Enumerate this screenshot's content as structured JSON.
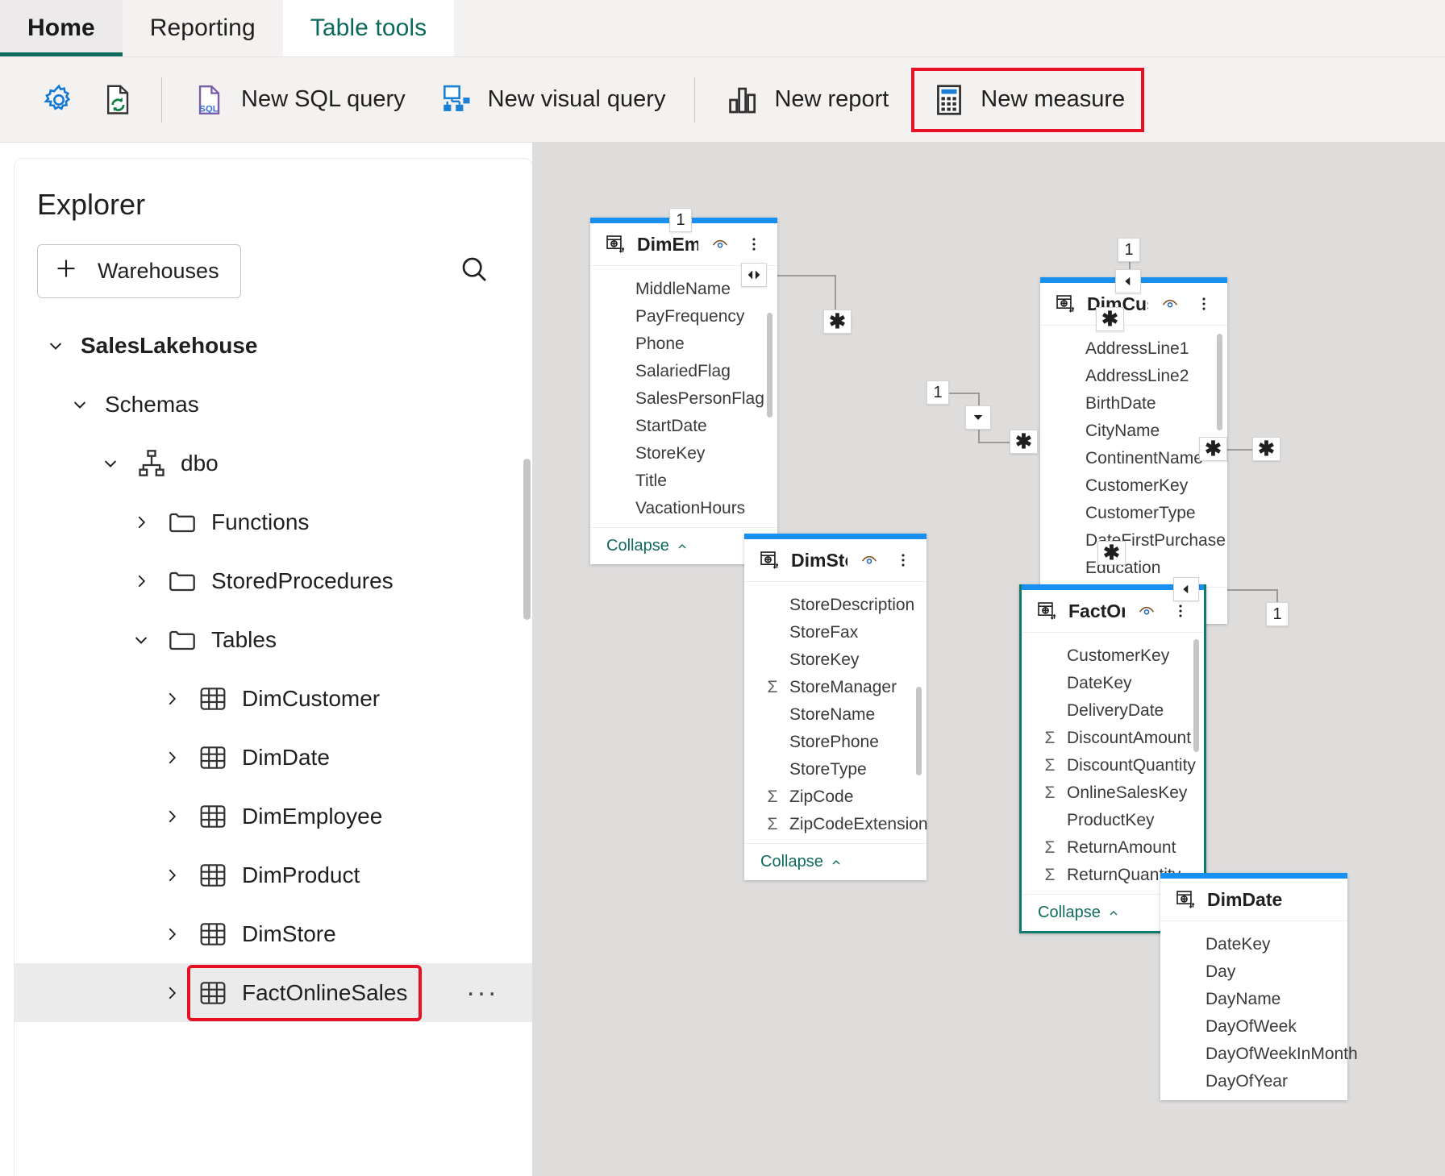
{
  "ribbon": {
    "tabs": [
      {
        "label": "Home",
        "state": "active"
      },
      {
        "label": "Reporting",
        "state": "normal"
      },
      {
        "label": "Table tools",
        "state": "current"
      }
    ],
    "commands": [
      {
        "label": "",
        "icon": "settings-gear-icon",
        "name": "settings-button"
      },
      {
        "label": "",
        "icon": "refresh-document-icon",
        "name": "refresh-button"
      },
      {
        "label": "New SQL query",
        "icon": "sql-file-icon",
        "name": "new-sql-query-button"
      },
      {
        "label": "New visual query",
        "icon": "visual-query-icon",
        "name": "new-visual-query-button"
      },
      {
        "label": "New report",
        "icon": "bar-chart-icon",
        "name": "new-report-button"
      },
      {
        "label": "New measure",
        "icon": "calculator-icon",
        "name": "new-measure-button",
        "highlighted": true
      }
    ]
  },
  "explorer": {
    "title": "Explorer",
    "warehouses_button": "Warehouses",
    "search_icon": "search-icon",
    "tree": [
      {
        "label": "SalesLakehouse",
        "level": 0,
        "chevron": "down",
        "icon": "none",
        "bold": true
      },
      {
        "label": "Schemas",
        "level": 1,
        "chevron": "down",
        "icon": "none",
        "bold": false
      },
      {
        "label": "dbo",
        "level": 2,
        "chevron": "down",
        "icon": "schema-icon",
        "bold": false
      },
      {
        "label": "Functions",
        "level": 3,
        "chevron": "right",
        "icon": "folder-icon",
        "bold": false
      },
      {
        "label": "StoredProcedures",
        "level": 3,
        "chevron": "right",
        "icon": "folder-icon",
        "bold": false
      },
      {
        "label": "Tables",
        "level": 3,
        "chevron": "down",
        "icon": "folder-icon",
        "bold": false
      },
      {
        "label": "DimCustomer",
        "level": 4,
        "chevron": "right",
        "icon": "table-icon",
        "bold": false
      },
      {
        "label": "DimDate",
        "level": 4,
        "chevron": "right",
        "icon": "table-icon",
        "bold": false
      },
      {
        "label": "DimEmployee",
        "level": 4,
        "chevron": "right",
        "icon": "table-icon",
        "bold": false
      },
      {
        "label": "DimProduct",
        "level": 4,
        "chevron": "right",
        "icon": "table-icon",
        "bold": false
      },
      {
        "label": "DimStore",
        "level": 4,
        "chevron": "right",
        "icon": "table-icon",
        "bold": false
      },
      {
        "label": "FactOnlineSales",
        "level": 4,
        "chevron": "right",
        "icon": "table-icon",
        "bold": false,
        "selected": true,
        "highlighted": true,
        "overflow": "···"
      }
    ]
  },
  "diagram": {
    "collapse_label": "Collapse",
    "tables": [
      {
        "name": "DimEmployee",
        "selected": false,
        "fields": [
          {
            "name": "MiddleName",
            "numeric": false
          },
          {
            "name": "PayFrequency",
            "numeric": false
          },
          {
            "name": "Phone",
            "numeric": false
          },
          {
            "name": "SalariedFlag",
            "numeric": false
          },
          {
            "name": "SalesPersonFlag",
            "numeric": false
          },
          {
            "name": "StartDate",
            "numeric": false
          },
          {
            "name": "StoreKey",
            "numeric": false
          },
          {
            "name": "Title",
            "numeric": false
          },
          {
            "name": "VacationHours",
            "numeric": false
          }
        ]
      },
      {
        "name": "DimCustomer",
        "selected": false,
        "fields": [
          {
            "name": "AddressLine1",
            "numeric": false
          },
          {
            "name": "AddressLine2",
            "numeric": false
          },
          {
            "name": "BirthDate",
            "numeric": false
          },
          {
            "name": "CityName",
            "numeric": false
          },
          {
            "name": "ContinentName",
            "numeric": false
          },
          {
            "name": "CustomerKey",
            "numeric": false
          },
          {
            "name": "CustomerType",
            "numeric": false
          },
          {
            "name": "DateFirstPurchase",
            "numeric": false
          },
          {
            "name": "Education",
            "numeric": false
          }
        ]
      },
      {
        "name": "DimStore",
        "selected": false,
        "fields": [
          {
            "name": "StoreDescription",
            "numeric": false
          },
          {
            "name": "StoreFax",
            "numeric": false
          },
          {
            "name": "StoreKey",
            "numeric": false
          },
          {
            "name": "StoreManager",
            "numeric": true
          },
          {
            "name": "StoreName",
            "numeric": false
          },
          {
            "name": "StorePhone",
            "numeric": false
          },
          {
            "name": "StoreType",
            "numeric": false
          },
          {
            "name": "ZipCode",
            "numeric": true
          },
          {
            "name": "ZipCodeExtension",
            "numeric": true
          }
        ]
      },
      {
        "name": "FactOnlineSales",
        "selected": true,
        "fields": [
          {
            "name": "CustomerKey",
            "numeric": false
          },
          {
            "name": "DateKey",
            "numeric": false
          },
          {
            "name": "DeliveryDate",
            "numeric": false
          },
          {
            "name": "DiscountAmount",
            "numeric": true
          },
          {
            "name": "DiscountQuantity",
            "numeric": true
          },
          {
            "name": "OnlineSalesKey",
            "numeric": true
          },
          {
            "name": "ProductKey",
            "numeric": false
          },
          {
            "name": "ReturnAmount",
            "numeric": true
          },
          {
            "name": "ReturnQuantity",
            "numeric": true
          }
        ]
      },
      {
        "name": "DimDate",
        "selected": false,
        "fields": [
          {
            "name": "DateKey",
            "numeric": false
          },
          {
            "name": "Day",
            "numeric": false
          },
          {
            "name": "DayName",
            "numeric": false
          },
          {
            "name": "DayOfWeek",
            "numeric": false
          },
          {
            "name": "DayOfWeekInMonth",
            "numeric": false
          },
          {
            "name": "DayOfYear",
            "numeric": false
          }
        ]
      }
    ],
    "cardinality": {
      "one": "1",
      "many": "✱"
    }
  },
  "colors": {
    "accent_teal": "#0f6b5c",
    "card_top_blue": "#1890f1",
    "highlight_red": "#e81123",
    "selected_card_border": "#0f7b6c"
  }
}
